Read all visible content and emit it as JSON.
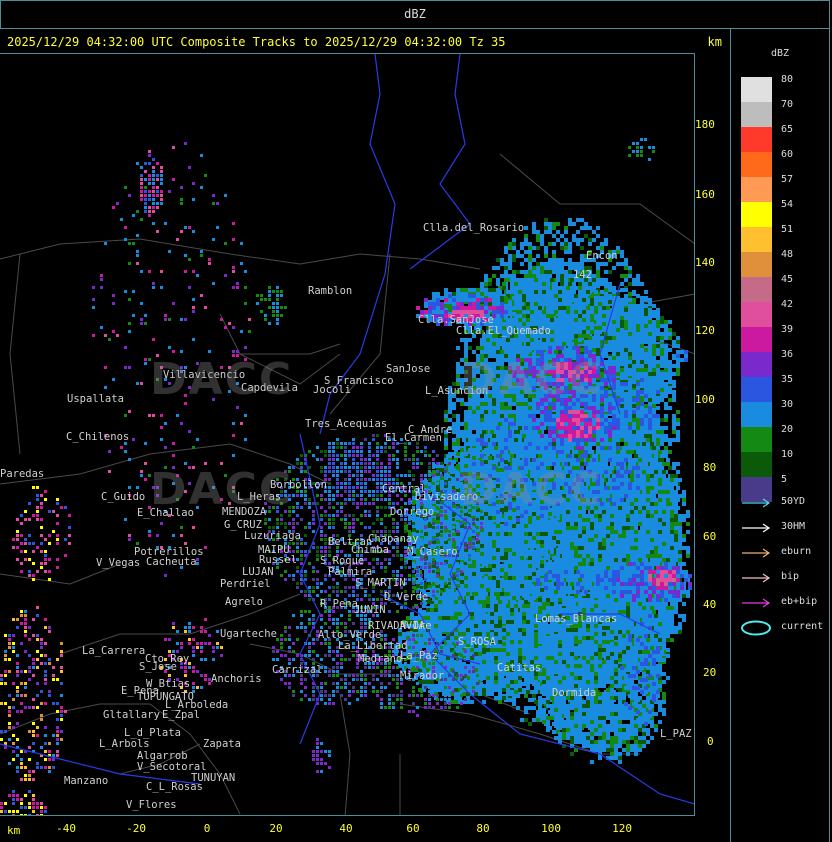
{
  "header": {
    "title": "dBZ"
  },
  "plot": {
    "title": "2025/12/29 04:32:00 UTC Composite Tracks to 2025/12/29 04:32:00 Tz 35",
    "unit": "km"
  },
  "axes": {
    "x_unit": "km",
    "x_ticks": [
      "-40",
      "-20",
      "0",
      "20",
      "40",
      "60",
      "80",
      "100",
      "120"
    ],
    "y_ticks": [
      "180",
      "160",
      "140",
      "120",
      "100",
      "80",
      "60",
      "40",
      "20",
      "0"
    ]
  },
  "legend": {
    "title": "dBZ",
    "levels": [
      {
        "label": "80",
        "color": "#e0e0e0"
      },
      {
        "label": "70",
        "color": "#bdbdbd"
      },
      {
        "label": "65",
        "color": "#ff3a2a"
      },
      {
        "label": "60",
        "color": "#ff6a1a"
      },
      {
        "label": "57",
        "color": "#ff9a55"
      },
      {
        "label": "54",
        "color": "#ffff00"
      },
      {
        "label": "51",
        "color": "#ffc030"
      },
      {
        "label": "48",
        "color": "#e0903a"
      },
      {
        "label": "45",
        "color": "#c66a8a"
      },
      {
        "label": "42",
        "color": "#e04f9e"
      },
      {
        "label": "39",
        "color": "#cc1aa0"
      },
      {
        "label": "36",
        "color": "#7a2acc"
      },
      {
        "label": "35",
        "color": "#2a56e0"
      },
      {
        "label": "30",
        "color": "#1a8ce0"
      },
      {
        "label": "20",
        "color": "#148a14"
      },
      {
        "label": "10",
        "color": "#0a5a0a"
      },
      {
        "label": "5",
        "color": "#4a3a8a"
      }
    ],
    "tracks": [
      {
        "label": "50YD",
        "color": "#4fd8e8"
      },
      {
        "label": "30HM",
        "color": "#ffffff"
      },
      {
        "label": "eburn",
        "color": "#f0b070"
      },
      {
        "label": "bip",
        "color": "#f0c0c0"
      },
      {
        "label": "eb+bip",
        "color": "#e040e0"
      },
      {
        "label": "current",
        "color": "#4fe8f0"
      }
    ]
  },
  "places": [
    {
      "name": "Clla.del_Rosario"
    },
    {
      "name": "Encon"
    },
    {
      "name": "142"
    },
    {
      "name": "Ramblon"
    },
    {
      "name": "Clla.SanJose"
    },
    {
      "name": "Clla.El_Quemado"
    },
    {
      "name": "SanJose"
    },
    {
      "name": "Villavicencio"
    },
    {
      "name": "Capdevila"
    },
    {
      "name": "S_Francisco"
    },
    {
      "name": "Jocoli"
    },
    {
      "name": "L_Asuncion"
    },
    {
      "name": "Uspallata"
    },
    {
      "name": "C_Chilenos"
    },
    {
      "name": "Tres_Acequias"
    },
    {
      "name": "C_Andre"
    },
    {
      "name": "El_Carmen"
    },
    {
      "name": "Paredas"
    },
    {
      "name": "C_Guido"
    },
    {
      "name": "L_Heras"
    },
    {
      "name": "Borbollon"
    },
    {
      "name": "Central"
    },
    {
      "name": "Divisadero"
    },
    {
      "name": "E_Challao"
    },
    {
      "name": "MENDOZA"
    },
    {
      "name": "G_CRUZ"
    },
    {
      "name": "Luzuriaga"
    },
    {
      "name": "Dorrego"
    },
    {
      "name": "Beltran"
    },
    {
      "name": "Chimba"
    },
    {
      "name": "Chapanay"
    },
    {
      "name": "M_Casero"
    },
    {
      "name": "Potrerillos"
    },
    {
      "name": "Cacheuta"
    },
    {
      "name": "V_Vegas"
    },
    {
      "name": "MAIPU"
    },
    {
      "name": "LUJAN"
    },
    {
      "name": "Russel"
    },
    {
      "name": "S_Roque"
    },
    {
      "name": "Palmira"
    },
    {
      "name": "S_MARTIN"
    },
    {
      "name": "D_Verde"
    },
    {
      "name": "Perdriel"
    },
    {
      "name": "Agrelo"
    },
    {
      "name": "R_Pena"
    },
    {
      "name": "JUNIN"
    },
    {
      "name": "Lomas_Blancas"
    },
    {
      "name": "Ugarteche"
    },
    {
      "name": "La_Carrera"
    },
    {
      "name": "Cto_Rey"
    },
    {
      "name": "S_Jose"
    },
    {
      "name": "Carrizal"
    },
    {
      "name": "Alto_Verde"
    },
    {
      "name": "La_Libertad"
    },
    {
      "name": "RIVADAVIA"
    },
    {
      "name": "Medrano"
    },
    {
      "name": "N_Ore"
    },
    {
      "name": "La_Paz"
    },
    {
      "name": "S_ROSA"
    },
    {
      "name": "Catitas"
    },
    {
      "name": "Dormida"
    },
    {
      "name": "Mirador"
    },
    {
      "name": "Anchoris"
    },
    {
      "name": "W_Btias"
    },
    {
      "name": "E_Pena"
    },
    {
      "name": "TUPUNGATO"
    },
    {
      "name": "L_Arboleda"
    },
    {
      "name": "Gltallary"
    },
    {
      "name": "E_Zpal"
    },
    {
      "name": "L_d_Plata"
    },
    {
      "name": "Zapata"
    },
    {
      "name": "L_Arbols"
    },
    {
      "name": "Algarrob"
    },
    {
      "name": "V_Secotoral"
    },
    {
      "name": "TUNUYAN"
    },
    {
      "name": "Manzano"
    },
    {
      "name": "C_L_Rosas"
    },
    {
      "name": "V_Flores"
    },
    {
      "name": "L_PAZ"
    }
  ],
  "watermark": {
    "text": "DACC"
  }
}
